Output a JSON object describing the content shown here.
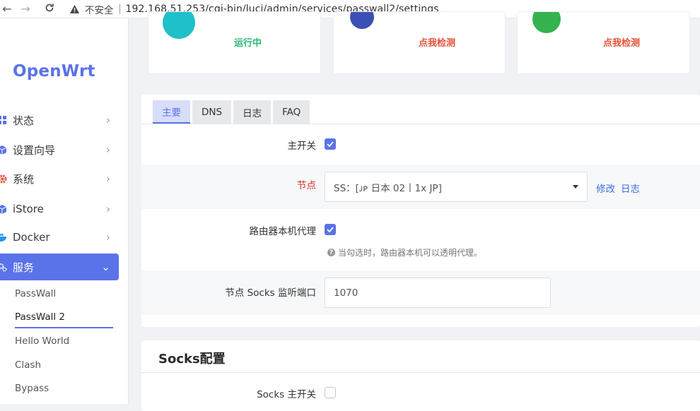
{
  "browser": {
    "security_label": "不安全",
    "url": "192.168.51.253/cgi-bin/luci/admin/services/passwall2/settings"
  },
  "sidebar": {
    "logo": "OpenWrt",
    "items": [
      {
        "label": "状态",
        "icon": "dashboard-icon"
      },
      {
        "label": "设置向导",
        "icon": "cube-icon"
      },
      {
        "label": "系统",
        "icon": "gear-icon"
      },
      {
        "label": "iStore",
        "icon": "cube-icon"
      },
      {
        "label": "Docker",
        "icon": "docker-icon"
      },
      {
        "label": "服务",
        "icon": "gears-icon"
      }
    ],
    "subitems": [
      "PassWall",
      "PassWall 2",
      "Hello World",
      "Clash",
      "Bypass"
    ]
  },
  "status_cards": [
    {
      "text": "运行中",
      "color": "#2bb673",
      "circle_color": "#20c0c8"
    },
    {
      "text": "点我检测",
      "color": "#e5533c",
      "circle_color": "#3c4fb5"
    },
    {
      "text": "点我检测",
      "color": "#e5533c",
      "circle_color": "#36b24f"
    }
  ],
  "tabs": [
    "主要",
    "DNS",
    "日志",
    "FAQ"
  ],
  "form": {
    "main_switch_label": "主开关",
    "node_label": "节点",
    "node_value": "SS：[ᴊᴘ 日本 02丨1x JP]",
    "edit_link": "修改",
    "log_link": "日志",
    "router_proxy_label": "路由器本机代理",
    "router_proxy_hint": "当勾选时，路由器本机可以透明代理。",
    "socks_port_label": "节点 Socks 监听端口",
    "socks_port_value": "1070"
  },
  "socks_section": {
    "title": "Socks配置",
    "switch_label": "Socks 主开关"
  },
  "colors": {
    "accent": "#5b73e8",
    "danger": "#d93025",
    "link": "#3d6fd6"
  }
}
